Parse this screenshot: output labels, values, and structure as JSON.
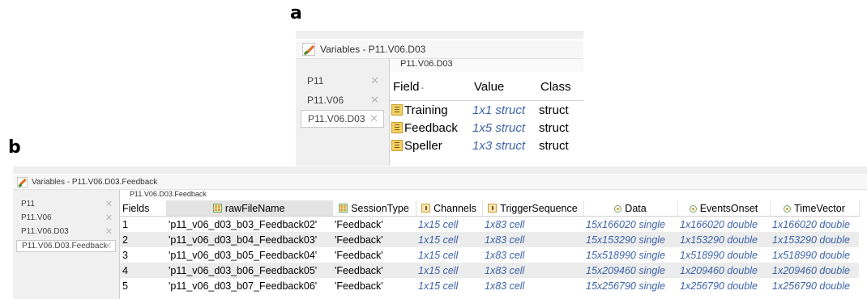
{
  "panel_labels": {
    "a": "a",
    "b": "b"
  },
  "window_a": {
    "title": "Variables - P11.V06.D03",
    "tabs": [
      {
        "label": "P11",
        "close": "✕"
      },
      {
        "label": "P11.V06",
        "close": "✕"
      },
      {
        "label": "P11.V06.D03",
        "close": "✕"
      }
    ],
    "path": "P11.V06.D03",
    "headers": {
      "field": "Field",
      "sort_marker": "-",
      "value": "Value",
      "class": "Class"
    },
    "rows": [
      {
        "field": "Training",
        "value": "1x1 struct",
        "class": "struct"
      },
      {
        "field": "Feedback",
        "value": "1x5 struct",
        "class": "struct"
      },
      {
        "field": "Speller",
        "value": "1x3 struct",
        "class": "struct"
      }
    ]
  },
  "window_b": {
    "title": "Variables - P11.V06.D03.Feedback",
    "tabs": [
      {
        "label": "P11",
        "close": "✕"
      },
      {
        "label": "P11.V06",
        "close": "✕"
      },
      {
        "label": "P11.V06.D03",
        "close": "✕"
      },
      {
        "label": "P11.V06.D03.Feedback",
        "close": "✕"
      }
    ],
    "path": "P11.V06.D03.Feedback",
    "headers": [
      "Fields",
      "rawFileName",
      "SessionType",
      "Channels",
      "TriggerSequence",
      "Data",
      "EventsOnset",
      "TimeVector"
    ],
    "header_icons": [
      "",
      "table-icon",
      "table-icon",
      "cell-icon",
      "cell-icon",
      "numeric-icon",
      "numeric-icon",
      "numeric-icon"
    ],
    "rows": [
      [
        "1",
        "'p11_v06_d03_b03_Feedback02'",
        "'Feedback'",
        "1x15 cell",
        "1x83 cell",
        "15x166020 single",
        "1x166020 double",
        "1x166020 double"
      ],
      [
        "2",
        "'p11_v06_d03_b04_Feedback03'",
        "'Feedback'",
        "1x15 cell",
        "1x83 cell",
        "15x153290 single",
        "1x153290 double",
        "1x153290 double"
      ],
      [
        "3",
        "'p11_v06_d03_b05_Feedback04'",
        "'Feedback'",
        "1x15 cell",
        "1x83 cell",
        "15x518990 single",
        "1x518990 double",
        "1x518990 double"
      ],
      [
        "4",
        "'p11_v06_d03_b06_Feedback05'",
        "'Feedback'",
        "1x15 cell",
        "1x83 cell",
        "15x209460 single",
        "1x209460 double",
        "1x209460 double"
      ],
      [
        "5",
        "'p11_v06_d03_b07_Feedback06'",
        "'Feedback'",
        "1x15 cell",
        "1x83 cell",
        "15x256790 single",
        "1x256790 double",
        "1x256790 double"
      ]
    ]
  },
  "colors": {
    "value_text": "#3c63a8",
    "sidebar_bg": "#f0f0f0",
    "row_alt": "#ececec"
  }
}
